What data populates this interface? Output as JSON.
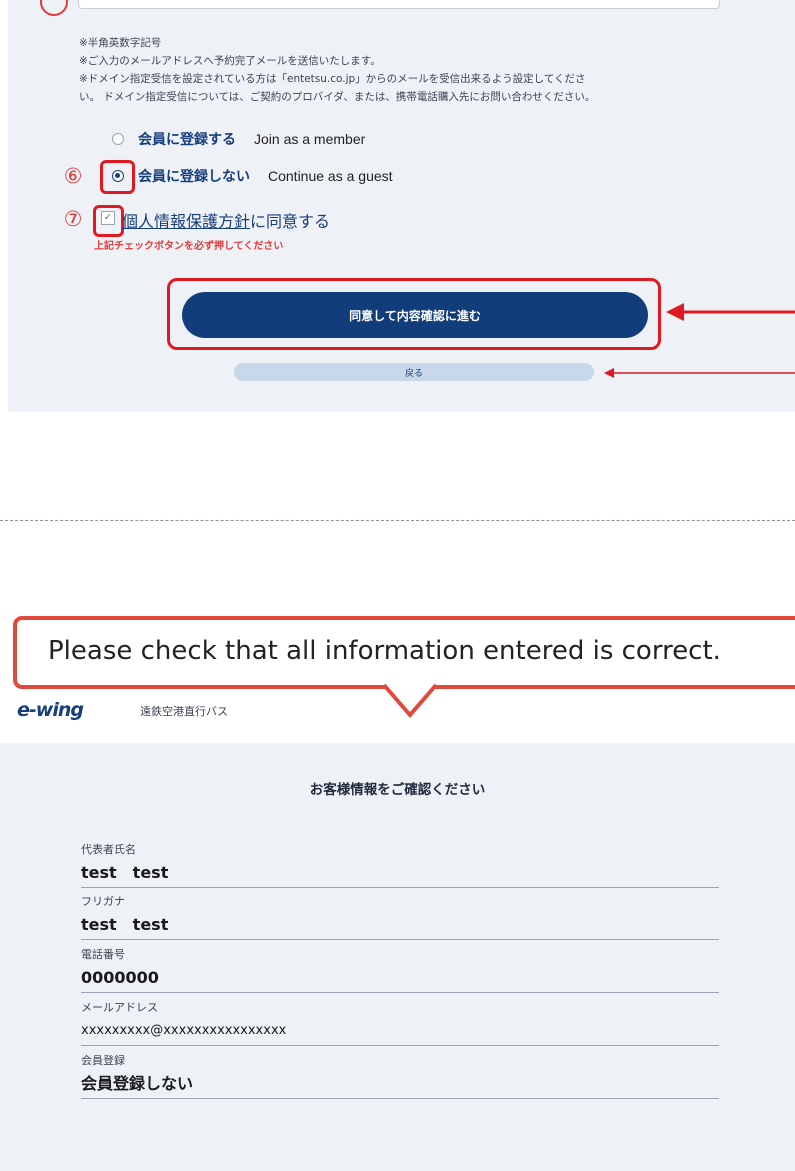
{
  "markers": {
    "six": "⑥",
    "seven": "⑦"
  },
  "notes": [
    "※半角英数字記号",
    "※ご入力のメールアドレスへ予約完了メールを送信いたします。",
    "※ドメイン指定受信を設定されている方は「entetsu.co.jp」からのメールを受信出来るよう設定してくださ",
    "い。 ドメイン指定受信については、ご契約のプロバイダ、または、携帯電話購入先にお問い合わせください。"
  ],
  "membership": {
    "options": [
      {
        "jp": "会員に登録する",
        "en": "Join as a member",
        "selected": false
      },
      {
        "jp": "会員に登録しない",
        "en": "Continue as a guest",
        "selected": true
      }
    ]
  },
  "privacy": {
    "link": "個人情報保護方針",
    "suffix": "に同意する",
    "checked": true,
    "warning": "上記チェックボタンを必ず押してください"
  },
  "buttons": {
    "primary": "同意して内容確認に進む",
    "back": "戻る"
  },
  "callout": {
    "text": "Please check that all information entered is correct."
  },
  "header": {
    "logo": "e-wing",
    "subtitle": "遠鉄空港直行バス"
  },
  "confirm": {
    "title": "お客様情報をご確認ください",
    "fields": [
      {
        "label": "代表者氏名",
        "value": "test　test"
      },
      {
        "label": "フリガナ",
        "value": "test　test"
      },
      {
        "label": "電話番号",
        "value": "0000000"
      },
      {
        "label": "メールアドレス",
        "value": "xxxxxxxxx@xxxxxxxxxxxxxxxx"
      },
      {
        "label": "会員登録",
        "value": "会員登録しない"
      }
    ]
  },
  "colors": {
    "accent": "#123d7b",
    "annotation_red": "#e01a22",
    "panel_bg": "#eef1f6"
  }
}
